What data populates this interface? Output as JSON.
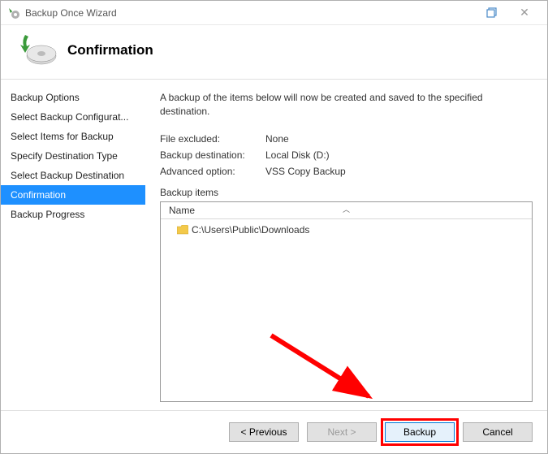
{
  "window": {
    "title": "Backup Once Wizard"
  },
  "header": {
    "title": "Confirmation"
  },
  "sidebar": {
    "items": [
      {
        "label": "Backup Options"
      },
      {
        "label": "Select Backup Configurat..."
      },
      {
        "label": "Select Items for Backup"
      },
      {
        "label": "Specify Destination Type"
      },
      {
        "label": "Select Backup Destination"
      },
      {
        "label": "Confirmation"
      },
      {
        "label": "Backup Progress"
      }
    ],
    "selected_index": 5
  },
  "main": {
    "intro": "A backup of the items below will now be created and saved to the specified destination.",
    "summary": {
      "file_excluded": {
        "label": "File excluded:",
        "value": "None"
      },
      "backup_destination": {
        "label": "Backup destination:",
        "value": "Local Disk (D:)"
      },
      "advanced_option": {
        "label": "Advanced option:",
        "value": "VSS Copy Backup"
      }
    },
    "items_section": {
      "label": "Backup items",
      "column_header": "Name",
      "items": [
        {
          "path": "C:\\Users\\Public\\Downloads"
        }
      ]
    }
  },
  "footer": {
    "previous": "<  Previous",
    "next": "Next  >",
    "backup": "Backup",
    "cancel": "Cancel"
  }
}
